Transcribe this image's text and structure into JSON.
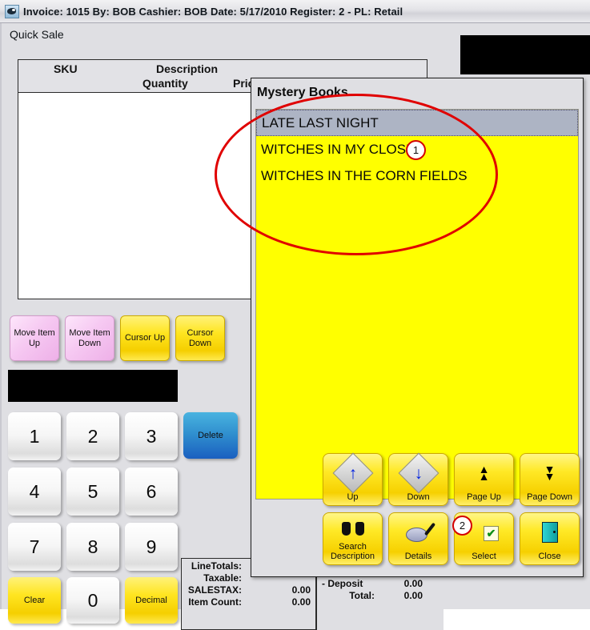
{
  "window": {
    "title": "Invoice: 1015  By: BOB  Cashier: BOB   Date:  5/17/2010  Register: 2 - PL: Retail",
    "page_title": "Quick Sale",
    "icon": "app-icon"
  },
  "grid": {
    "columns": {
      "sku": "SKU",
      "description": "Description",
      "quantity": "Quantity",
      "price": "Price"
    },
    "scroll_up_icon": "chevron-up-icon",
    "rows": []
  },
  "left_buttons": [
    {
      "label": "Move Item Up",
      "color": "#f6c9f2"
    },
    {
      "label": "Move Item Down",
      "color": "#f6c9f2"
    },
    {
      "label": "Cursor Up",
      "color": "#ffe521"
    },
    {
      "label": "Cursor Down",
      "color": "#ffe521"
    }
  ],
  "entry_display": {
    "value": ""
  },
  "keypad": {
    "keys": [
      {
        "label": "1",
        "type": "num"
      },
      {
        "label": "2",
        "type": "num"
      },
      {
        "label": "3",
        "type": "num"
      },
      {
        "label": "Delete",
        "type": "action"
      },
      {
        "label": "4",
        "type": "num"
      },
      {
        "label": "5",
        "type": "num"
      },
      {
        "label": "6",
        "type": "num"
      },
      {
        "label": "7",
        "type": "num"
      },
      {
        "label": "8",
        "type": "num"
      },
      {
        "label": "9",
        "type": "num"
      },
      {
        "label": "Clear",
        "type": "action"
      },
      {
        "label": "0",
        "type": "num"
      },
      {
        "label": "Decimal",
        "type": "action"
      }
    ]
  },
  "totals_left": {
    "rows": [
      {
        "label": "LineTotals:",
        "value": ""
      },
      {
        "label": "Taxable:",
        "value": ""
      },
      {
        "label": "SALESTAX:",
        "value": "0.00"
      },
      {
        "label": "Item Count:",
        "value": "0.00"
      }
    ]
  },
  "totals_right": {
    "rows": [
      {
        "label": "- Deposit",
        "value": "0.00"
      },
      {
        "label": "Total:",
        "value": "0.00"
      }
    ]
  },
  "dialog": {
    "title": "Mystery Books",
    "items": [
      {
        "label": "LATE LAST NIGHT",
        "selected": true
      },
      {
        "label": "WITCHES IN MY CLOSET",
        "selected": false
      },
      {
        "label": "WITCHES IN THE CORN FIELDS",
        "selected": false
      }
    ],
    "buttons": [
      {
        "label": "Up",
        "icon": "arrow-up-icon"
      },
      {
        "label": "Down",
        "icon": "arrow-down-icon"
      },
      {
        "label": "Page Up",
        "icon": "double-arrow-up-icon"
      },
      {
        "label": "Page Down",
        "icon": "double-arrow-down-icon"
      },
      {
        "label": "Search\nDescription",
        "icon": "binoculars-icon"
      },
      {
        "label": "Details",
        "icon": "magnifier-icon"
      },
      {
        "label": "Select",
        "icon": "checkmark-icon"
      },
      {
        "label": "Close",
        "icon": "door-exit-icon"
      }
    ],
    "button_labels": {
      "up": "Up",
      "down": "Down",
      "page_up": "Page Up",
      "page_down": "Page Down",
      "search_line1": "Search",
      "search_line2": "Description",
      "details": "Details",
      "select": "Select",
      "close": "Close"
    }
  },
  "annotations": {
    "marker_1": "1",
    "marker_2": "2",
    "ellipse_color": "#e00000"
  }
}
